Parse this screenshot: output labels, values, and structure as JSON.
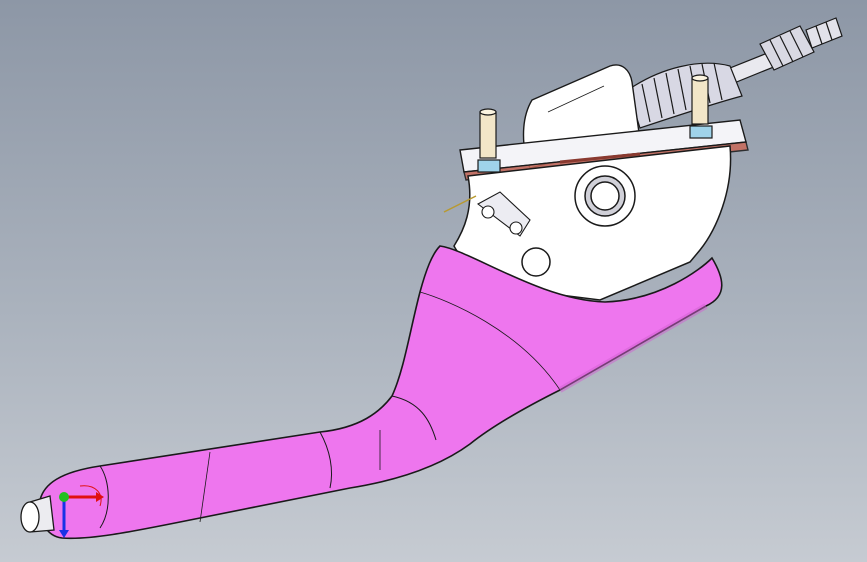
{
  "viewport": {
    "background_top": "#8d97a6",
    "background_bottom": "#c6cbd2"
  },
  "model": {
    "handle_color": "#ee76ee",
    "handle_shade": "#d25fd2",
    "housing_color": "#ffffff",
    "boot_color": "#d8d8e4",
    "post_color": "#f2e6c8",
    "edge_color": "#1a1a1a"
  },
  "triad": {
    "x_axis_color": "#e01010",
    "y_axis_color": "#22c022",
    "z_axis_color": "#1a32e6"
  }
}
